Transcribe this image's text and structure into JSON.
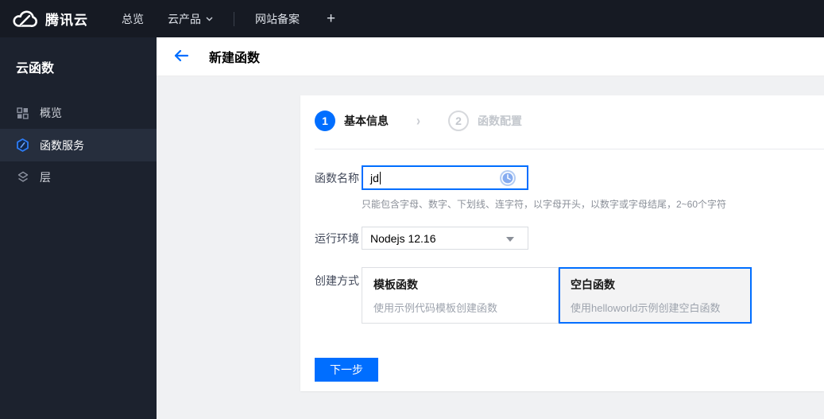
{
  "colors": {
    "accent": "#006eff",
    "topbar_bg": "#161a23",
    "sidebar_bg": "#1c222e",
    "sidebar_active_bg": "#262e3d",
    "content_bg": "#f0f1f3",
    "selected_card_bg": "#f3f3f4"
  },
  "topbar": {
    "brand": "腾讯云",
    "overview": "总览",
    "products": "云产品",
    "icp": "网站备案",
    "plus": "+"
  },
  "sidebar": {
    "title": "云函数",
    "items": [
      {
        "label": "概览",
        "icon": "grid-icon",
        "active": false
      },
      {
        "label": "函数服务",
        "icon": "function-service-icon",
        "active": true
      },
      {
        "label": "层",
        "icon": "layers-icon",
        "active": false
      }
    ]
  },
  "header": {
    "title": "新建函数"
  },
  "steps": [
    {
      "number": "1",
      "label": "基本信息",
      "active": true
    },
    {
      "number": "2",
      "label": "函数配置",
      "active": false
    }
  ],
  "step_separator": "›",
  "form": {
    "name": {
      "label": "函数名称",
      "value": "jd",
      "hint": "只能包含字母、数字、下划线、连字符，以字母开头，以数字或字母结尾，2~60个字符"
    },
    "runtime": {
      "label": "运行环境",
      "value": "Nodejs 12.16"
    },
    "method": {
      "label": "创建方式",
      "options": [
        {
          "title": "模板函数",
          "desc": "使用示例代码模板创建函数",
          "selected": false
        },
        {
          "title": "空白函数",
          "desc": "使用helloworld示例创建空白函数",
          "selected": true
        }
      ]
    }
  },
  "actions": {
    "next": "下一步"
  }
}
